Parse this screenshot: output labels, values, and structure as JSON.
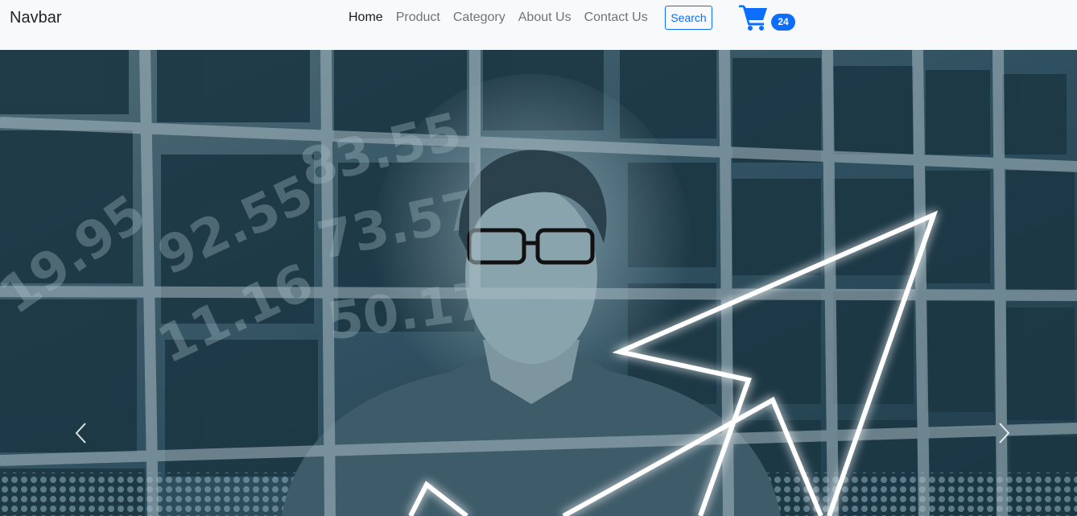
{
  "navbar": {
    "brand": "Navbar",
    "links": [
      {
        "label": "Home",
        "active": true
      },
      {
        "label": "Product",
        "active": false
      },
      {
        "label": "Category",
        "active": false
      },
      {
        "label": "About Us",
        "active": false
      },
      {
        "label": "Contact Us",
        "active": false
      }
    ],
    "search_label": "Search",
    "cart": {
      "icon": "cart-icon",
      "count": "24"
    }
  },
  "carousel": {
    "image": "man-with-stock-numbers-and-rising-arrow",
    "prev_icon": "chevron-left-icon",
    "next_icon": "chevron-right-icon"
  },
  "colors": {
    "accent": "#0d6efd",
    "navbar_bg": "#f8f9fa",
    "hero_tint": "#2a4a58"
  }
}
